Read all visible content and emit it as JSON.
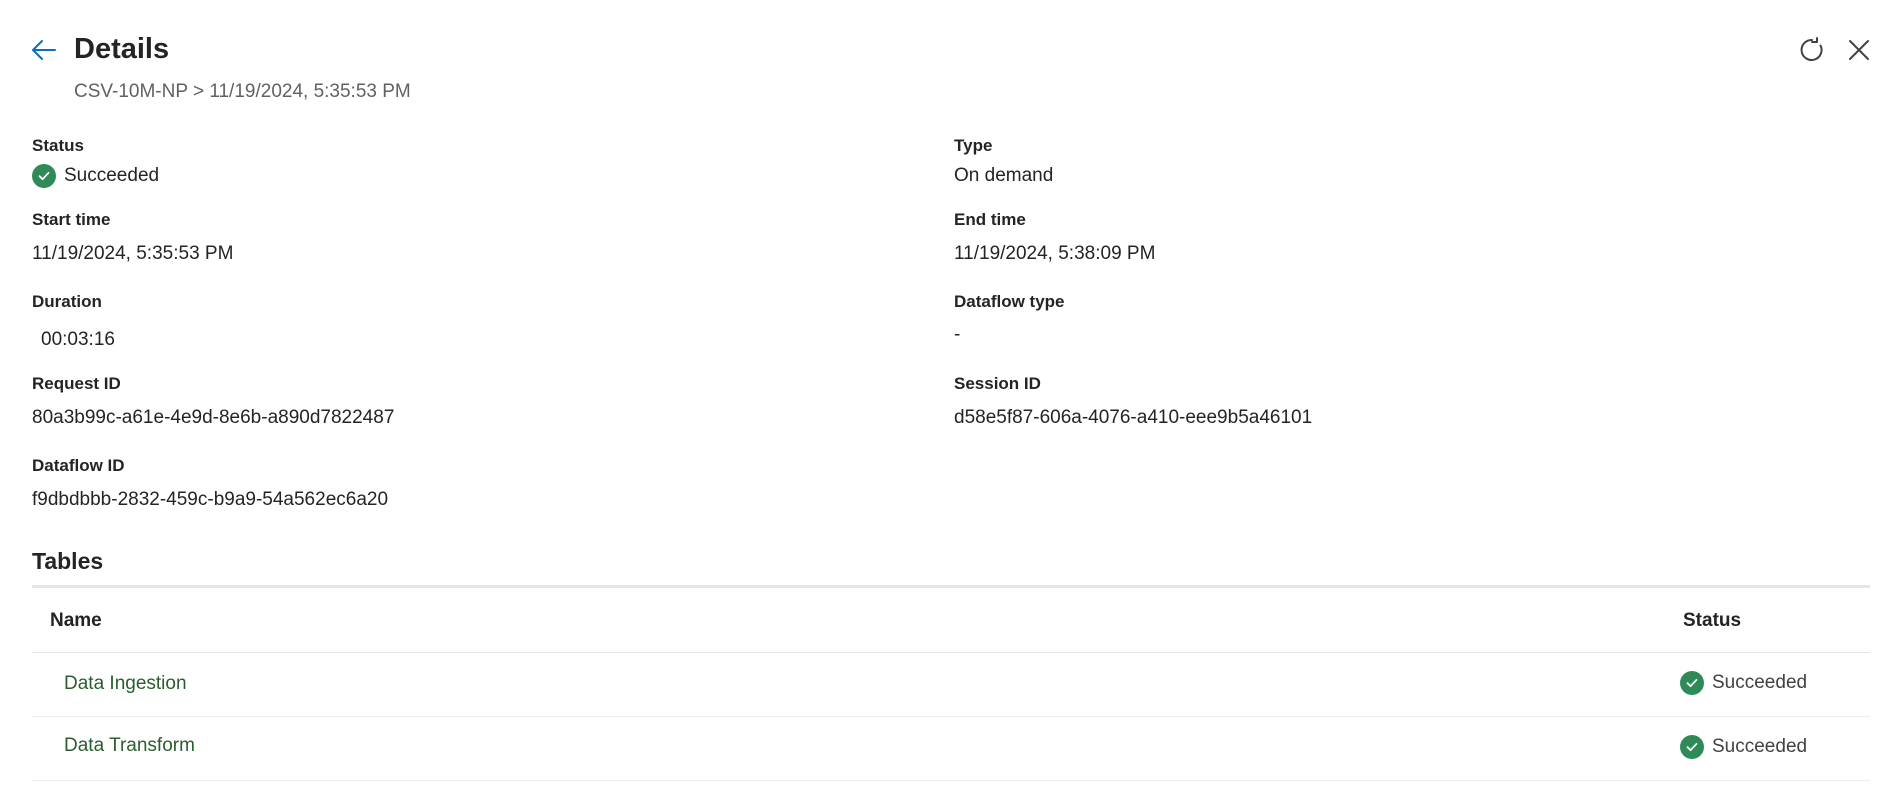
{
  "header": {
    "title": "Details",
    "breadcrumb": "CSV-10M-NP > 11/19/2024, 5:35:53 PM"
  },
  "fields": {
    "status": {
      "label": "Status",
      "value": "Succeeded"
    },
    "type": {
      "label": "Type",
      "value": "On demand"
    },
    "start_time": {
      "label": "Start time",
      "value": "11/19/2024, 5:35:53 PM"
    },
    "end_time": {
      "label": "End time",
      "value": "11/19/2024, 5:38:09 PM"
    },
    "duration": {
      "label": "Duration",
      "value": "00:03:16"
    },
    "dataflow_type": {
      "label": "Dataflow type",
      "value": "-"
    },
    "request_id": {
      "label": "Request ID",
      "value": "80a3b99c-a61e-4e9d-8e6b-a890d7822487"
    },
    "session_id": {
      "label": "Session ID",
      "value": "d58e5f87-606a-4076-a410-eee9b5a46101"
    },
    "dataflow_id": {
      "label": "Dataflow ID",
      "value": "f9dbdbbb-2832-459c-b9a9-54a562ec6a20"
    }
  },
  "tables": {
    "title": "Tables",
    "columns": [
      "Name",
      "Status"
    ],
    "rows": [
      {
        "name": "Data Ingestion",
        "status": "Succeeded"
      },
      {
        "name": "Data Transform",
        "status": "Succeeded"
      }
    ]
  },
  "icons": {
    "back": "arrow-left-icon",
    "refresh": "refresh-icon",
    "close": "close-icon",
    "success": "success-check-icon"
  },
  "colors": {
    "accent": "#0f6cbd",
    "success": "#2e8b57",
    "link": "#2b5c2f"
  }
}
